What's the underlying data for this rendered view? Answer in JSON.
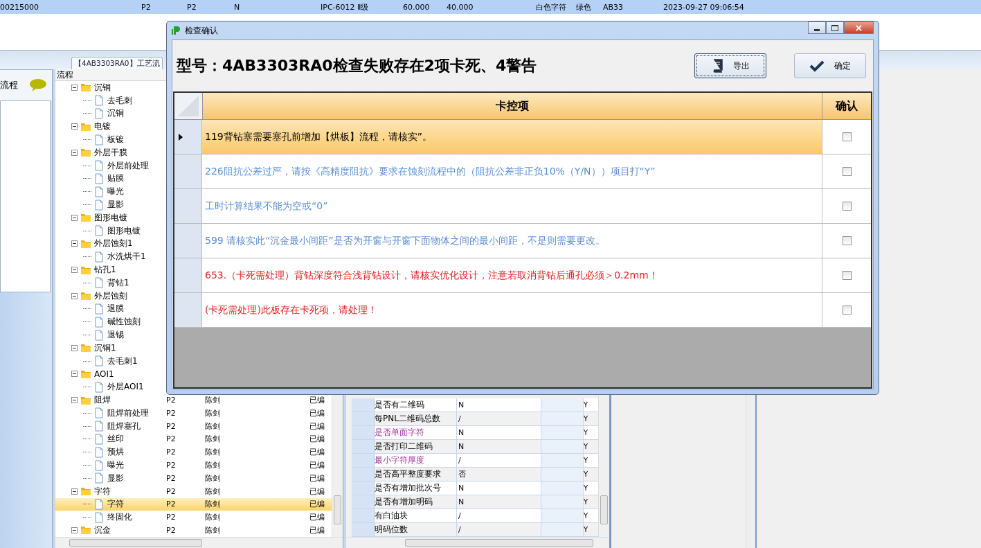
{
  "top_row": {
    "cells": [
      "00215000",
      "P2",
      "P2",
      "N",
      "IPC-6012 Ⅱ级",
      "60.000",
      "40.000",
      "白色字符",
      "绿色",
      "AB33",
      "2023-09-27 09:06:54"
    ]
  },
  "document_tab": {
    "label": "【4AB3303RA0】工艺流",
    "selected": true
  },
  "left_panel": {
    "title": "流程"
  },
  "tree": {
    "header": "流程",
    "items": [
      {
        "label": "沉铜",
        "expanded": true,
        "selected": false,
        "children": [
          {
            "label": "去毛刺",
            "selected": false
          },
          {
            "label": "沉铜",
            "selected": false
          }
        ]
      },
      {
        "label": "电镀",
        "expanded": true,
        "selected": false,
        "children": [
          {
            "label": "板镀",
            "selected": false
          }
        ]
      },
      {
        "label": "外层干膜",
        "expanded": true,
        "selected": false,
        "children": [
          {
            "label": "外层前处理",
            "selected": false
          },
          {
            "label": "贴膜",
            "selected": false
          },
          {
            "label": "曝光",
            "selected": false
          },
          {
            "label": "显影",
            "selected": false
          }
        ]
      },
      {
        "label": "图形电镀",
        "expanded": true,
        "selected": false,
        "children": [
          {
            "label": "图形电镀",
            "selected": false
          }
        ]
      },
      {
        "label": "外层蚀刻1",
        "expanded": true,
        "selected": false,
        "children": [
          {
            "label": "水洗烘干1",
            "selected": false
          }
        ]
      },
      {
        "label": "钻孔1",
        "expanded": true,
        "selected": false,
        "children": [
          {
            "label": "背钻1",
            "selected": false
          }
        ]
      },
      {
        "label": "外层蚀刻",
        "expanded": true,
        "selected": false,
        "children": [
          {
            "label": "退膜",
            "selected": false
          },
          {
            "label": "碱性蚀刻",
            "selected": false
          },
          {
            "label": "退锡",
            "selected": false
          }
        ]
      },
      {
        "label": "沉铜1",
        "expanded": true,
        "selected": false,
        "children": [
          {
            "label": "去毛刺1",
            "selected": false
          }
        ]
      },
      {
        "label": "AOI1",
        "expanded": true,
        "selected": false,
        "children": [
          {
            "label": "外层AOI1",
            "selected": false
          }
        ]
      },
      {
        "label": "阻焊",
        "expanded": true,
        "selected": false,
        "cells": [
          "P2",
          "陈剑",
          "已编"
        ],
        "children": [
          {
            "label": "阻焊前处理",
            "selected": false,
            "cells": [
              "P2",
              "陈剑",
              "已编"
            ]
          },
          {
            "label": "阻焊塞孔",
            "selected": false,
            "cells": [
              "P2",
              "陈剑",
              "已编"
            ]
          },
          {
            "label": "丝印",
            "selected": false,
            "cells": [
              "P2",
              "陈剑",
              "已编"
            ]
          },
          {
            "label": "预烘",
            "selected": false,
            "cells": [
              "P2",
              "陈剑",
              "已编"
            ]
          },
          {
            "label": "曝光",
            "selected": false,
            "cells": [
              "P2",
              "陈剑",
              "已编"
            ]
          },
          {
            "label": "显影",
            "selected": false,
            "cells": [
              "P2",
              "陈剑",
              "已编"
            ]
          }
        ]
      },
      {
        "label": "字符",
        "expanded": true,
        "selected": false,
        "cells": [
          "P2",
          "陈剑",
          "已编"
        ],
        "children": [
          {
            "label": "字符",
            "selected": true,
            "cells": [
              "P2",
              "陈剑",
              "已编"
            ]
          },
          {
            "label": "终固化",
            "selected": false,
            "cells": [
              "P2",
              "陈剑",
              "已编"
            ]
          }
        ]
      },
      {
        "label": "沉金",
        "expanded": true,
        "selected": false,
        "cells": [
          "P2",
          "陈剑",
          "已编"
        ]
      }
    ]
  },
  "property_grid": {
    "rows": [
      {
        "label": "是否有二维码",
        "value": "N",
        "flag": "Y",
        "emphasis": false
      },
      {
        "label": "每PNL二维码总数",
        "value": "/",
        "flag": "Y",
        "emphasis": false
      },
      {
        "label": "是否单面字符",
        "value": "N",
        "flag": "Y",
        "emphasis": true
      },
      {
        "label": "是否打印二维码",
        "value": "N",
        "flag": "Y",
        "emphasis": false
      },
      {
        "label": "最小字符厚度",
        "value": "/",
        "flag": "Y",
        "emphasis": true
      },
      {
        "label": "是否高平整度要求",
        "value": "否",
        "flag": "Y",
        "emphasis": false
      },
      {
        "label": "是否有增加批次号",
        "value": "N",
        "flag": "Y",
        "emphasis": false
      },
      {
        "label": "是否有增加明码",
        "value": "N",
        "flag": "Y",
        "emphasis": false
      },
      {
        "label": "有白油块",
        "value": "/",
        "flag": "Y",
        "emphasis": false
      },
      {
        "label": "明码位数",
        "value": "/",
        "flag": "Y",
        "emphasis": false
      }
    ]
  },
  "dialog": {
    "title": "检查确认",
    "heading": "型号：4AB3303RA0检查失败存在2项卡死、4警告",
    "buttons": [
      {
        "label": "导出",
        "kind": "export",
        "focused": true
      },
      {
        "label": "确定",
        "kind": "confirm",
        "focused": false
      }
    ],
    "columns": [
      "卡控项",
      "确认"
    ],
    "rows": [
      {
        "text": "119背钻塞需要塞孔前增加【烘板】流程，请核实”。",
        "selected": true,
        "checked": false
      },
      {
        "text": "226阻抗公差过严，请按《高精度阻抗》要求在蚀刻流程中的（阻抗公差非正负10%（Y/N））项目打“Y”",
        "kind": "warning",
        "selected": false,
        "checked": false
      },
      {
        "text": "工时计算结果不能为空或“0”",
        "kind": "warning",
        "selected": false,
        "checked": false
      },
      {
        "text": "599 请核实此“沉金最小间距”是否为开窗与开窗下面物体之间的最小间距，不是则需要更改。",
        "kind": "warning",
        "selected": false,
        "checked": false
      },
      {
        "text": "653.（卡死需处理）背钻深度符合浅背钻设计，请核实优化设计，注意若取消背钻后通孔必须＞0.2mm！",
        "kind": "blocking",
        "selected": false,
        "checked": false
      },
      {
        "text": "(卡死需处理)此板存在卡死项，请处理！",
        "kind": "blocking",
        "selected": false,
        "checked": false
      }
    ]
  }
}
